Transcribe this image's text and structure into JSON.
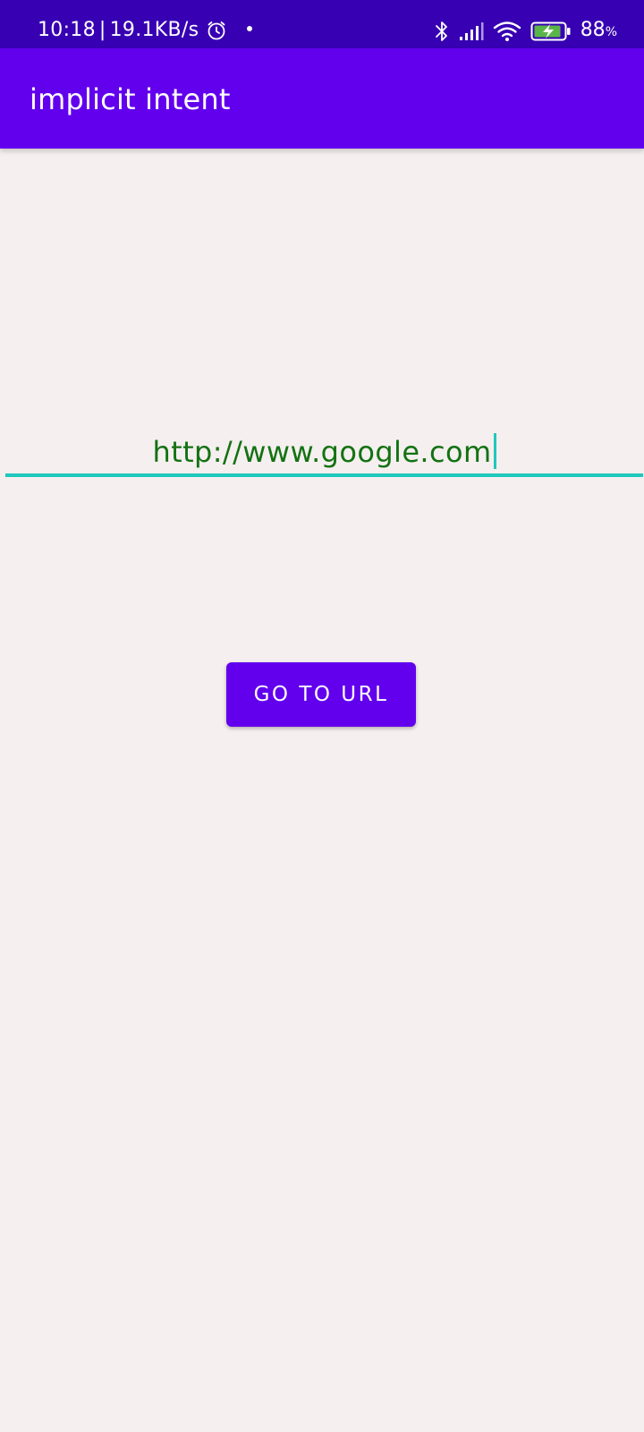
{
  "status_bar": {
    "time": "10:18",
    "separator": "|",
    "network_speed": "19.1KB/s",
    "battery_level": "88",
    "battery_unit": "%",
    "icons": [
      "alarm-icon",
      "notification-dot-icon",
      "bluetooth-icon",
      "signal-icon",
      "wifi-icon",
      "battery-charging-icon"
    ]
  },
  "app_bar": {
    "title": "implicit intent"
  },
  "url_input": {
    "value": "http://www.google.com"
  },
  "go_button": {
    "label": "GO TO URL"
  },
  "colors": {
    "status_bar": "#3700b3",
    "primary": "#6200ee",
    "background": "#f5efef",
    "input_text": "#137212",
    "input_accent": "#1ec8bd",
    "battery_fill": "#5ab548"
  }
}
